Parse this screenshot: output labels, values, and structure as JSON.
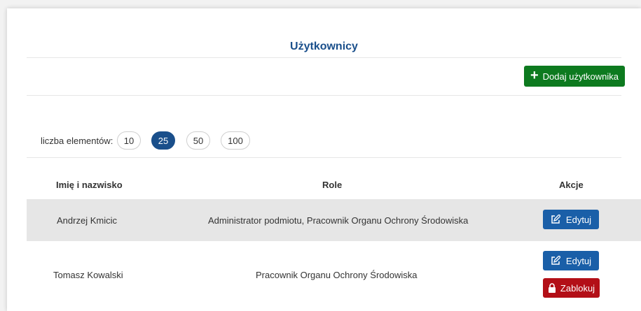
{
  "page": {
    "title": "Użytkownicy"
  },
  "toolbar": {
    "add_user_label": "Dodaj użytkownika",
    "add_icon": "plus-icon"
  },
  "pagination": {
    "label": "liczba elementów:",
    "options": [
      "10",
      "25",
      "50",
      "100"
    ],
    "selected": "25"
  },
  "table": {
    "headers": {
      "name": "Imię i nazwisko",
      "roles": "Role",
      "actions": "Akcje"
    },
    "rows": [
      {
        "name": "Andrzej Kmicic",
        "roles": "Administrator podmiotu, Pracownik Organu Ochrony Środowiska",
        "edit_label": "Edytuj"
      },
      {
        "name": "Tomasz Kowalski",
        "roles": "Pracownik Organu Ochrony Środowiska",
        "edit_label": "Edytuj",
        "block_label": "Zablokuj"
      }
    ]
  },
  "colors": {
    "primary": "#1a4f8b",
    "success": "#0d7a1f",
    "danger": "#b30f17",
    "row_highlight": "#e6e6e6"
  }
}
